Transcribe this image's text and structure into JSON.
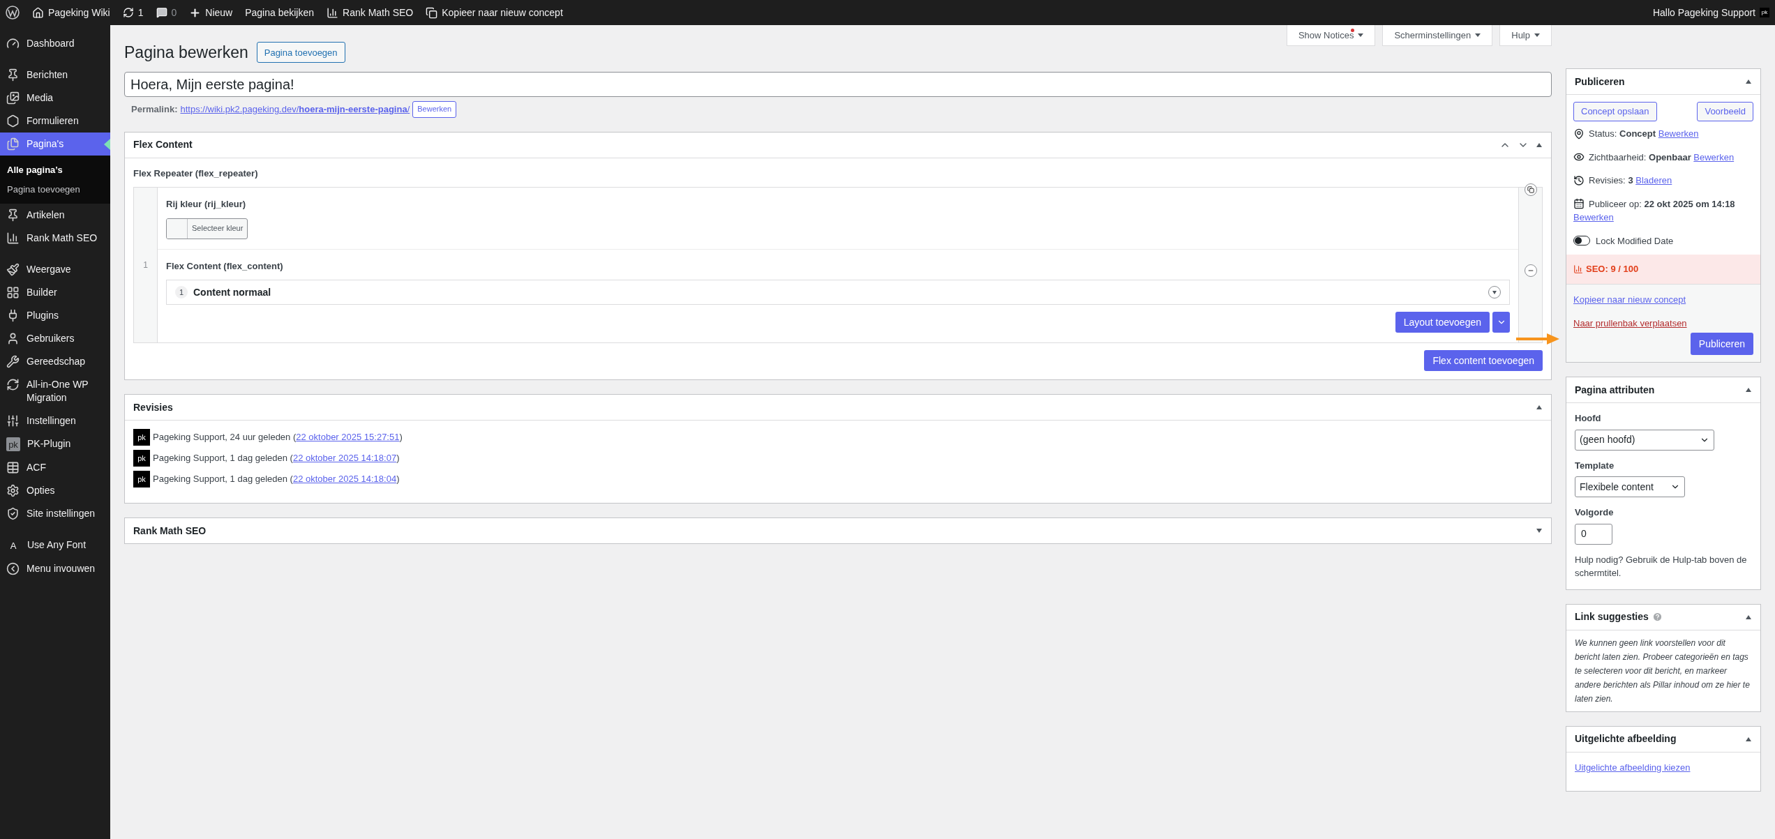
{
  "admin_bar": {
    "site": "Pageking Wiki",
    "updates": "1",
    "comments": "0",
    "new": "Nieuw",
    "view": "Pagina bekijken",
    "seo": "Rank Math SEO",
    "copy": "Kopieer naar nieuw concept",
    "greeting": "Hallo Pageking Support",
    "avatar": "pk"
  },
  "sidebar": {
    "items": [
      {
        "label": "Dashboard",
        "selected": false
      },
      {
        "label": "Berichten",
        "selected": false
      },
      {
        "label": "Media",
        "selected": false
      },
      {
        "label": "Formulieren",
        "selected": false
      },
      {
        "label": "Pagina's",
        "selected": true,
        "children": [
          {
            "label": "Alle pagina’s",
            "selected": true
          },
          {
            "label": "Pagina toevoegen",
            "selected": false
          }
        ]
      },
      {
        "label": "Artikelen",
        "selected": false
      },
      {
        "label": "Rank Math SEO",
        "selected": false
      },
      {
        "label": "Weergave",
        "selected": false
      },
      {
        "label": "Builder",
        "selected": false
      },
      {
        "label": "Plugins",
        "selected": false
      },
      {
        "label": "Gebruikers",
        "selected": false
      },
      {
        "label": "Gereedschap",
        "selected": false
      },
      {
        "label": "All-in-One WP Migration",
        "selected": false
      },
      {
        "label": "Instellingen",
        "selected": false
      },
      {
        "label": "PK-Plugin",
        "selected": false,
        "icon_text": "pk"
      },
      {
        "label": "ACF",
        "selected": false
      },
      {
        "label": "Opties",
        "selected": false
      },
      {
        "label": "Site instellingen",
        "selected": false
      },
      {
        "label": "Use Any Font",
        "selected": false,
        "icon_text": "A"
      },
      {
        "label": "Menu invouwen",
        "selected": false
      }
    ]
  },
  "screen_meta": [
    {
      "label": "Show Notices",
      "alert": true
    },
    {
      "label": "Scherminstellingen",
      "alert": false
    },
    {
      "label": "Hulp",
      "alert": false
    }
  ],
  "heading": {
    "title": "Pagina bewerken",
    "add_button": "Pagina toevoegen"
  },
  "post_title": "Hoera, Mijn eerste pagina!",
  "permalink": {
    "label": "Permalink:",
    "base": "https://wiki.pk2.pageking.dev/",
    "slug": "hoera-mijn-eerste-pagina",
    "end": "/",
    "button": "Bewerken"
  },
  "flex_box": {
    "title": "Flex Content",
    "repeater_label": "Flex Repeater (flex_repeater)",
    "row_number": "1",
    "color_field": "Rij kleur (rij_kleur)",
    "color_button": "Selecteer kleur",
    "flex_label": "Flex Content (flex_content)",
    "layouts": [
      {
        "number": "1",
        "title": "Content normaal"
      }
    ],
    "add_layout": "Layout toevoegen",
    "add_flex": "Flex content toevoegen"
  },
  "revisions": {
    "title": "Revisies",
    "rows": [
      {
        "avatar": "pk",
        "text": "Pageking Support, 24 uur geleden (",
        "link": "22 oktober 2025 15:27:51",
        "after": ")"
      },
      {
        "avatar": "pk",
        "text": "Pageking Support, 1 dag geleden (",
        "link": "22 oktober 2025 14:18:07",
        "after": ")"
      },
      {
        "avatar": "pk",
        "text": "Pageking Support, 1 dag geleden (",
        "link": "22 oktober 2025 14:18:04",
        "after": ")"
      }
    ]
  },
  "rank_math_box": {
    "title": "Rank Math SEO"
  },
  "publish": {
    "title": "Publiceren",
    "save": "Concept opslaan",
    "preview": "Voorbeeld",
    "rows": [
      {
        "label": "Status:",
        "value": "Concept",
        "link": "Bewerken"
      },
      {
        "label": "Zichtbaarheid:",
        "value": "Openbaar",
        "link": "Bewerken"
      },
      {
        "label": "Revisies:",
        "value": "3",
        "link": "Bladeren"
      },
      {
        "label": "Publiceer op:",
        "value": "22 okt 2025 om 14:18",
        "link": "Bewerken"
      }
    ],
    "toggle": {
      "label": "Lock Modified Date",
      "on": false
    },
    "seo": "SEO: 9 / 100",
    "copy_link": "Kopieer naar nieuw concept",
    "trash_link": "Naar prullenbak verplaatsen",
    "publish_button": "Publiceren"
  },
  "attributes": {
    "title": "Pagina attributen",
    "parent_label": "Hoofd",
    "parent_value": "(geen hoofd)",
    "template_label": "Template",
    "template_value": "Flexibele content",
    "order_label": "Volgorde",
    "order_value": "0",
    "help": "Hulp nodig? Gebruik de Hulp-tab boven de schermtitel."
  },
  "link_suggestions": {
    "title": "Link suggesties",
    "text": "We kunnen geen link voorstellen voor dit bericht laten zien. Probeer categorieën en tags te selecteren voor dit bericht, en markeer andere berichten als Pillar inhoud om ze hier te laten zien."
  },
  "featured_image": {
    "title": "Uitgelichte afbeelding",
    "link": "Uitgelichte afbeelding kiezen"
  }
}
